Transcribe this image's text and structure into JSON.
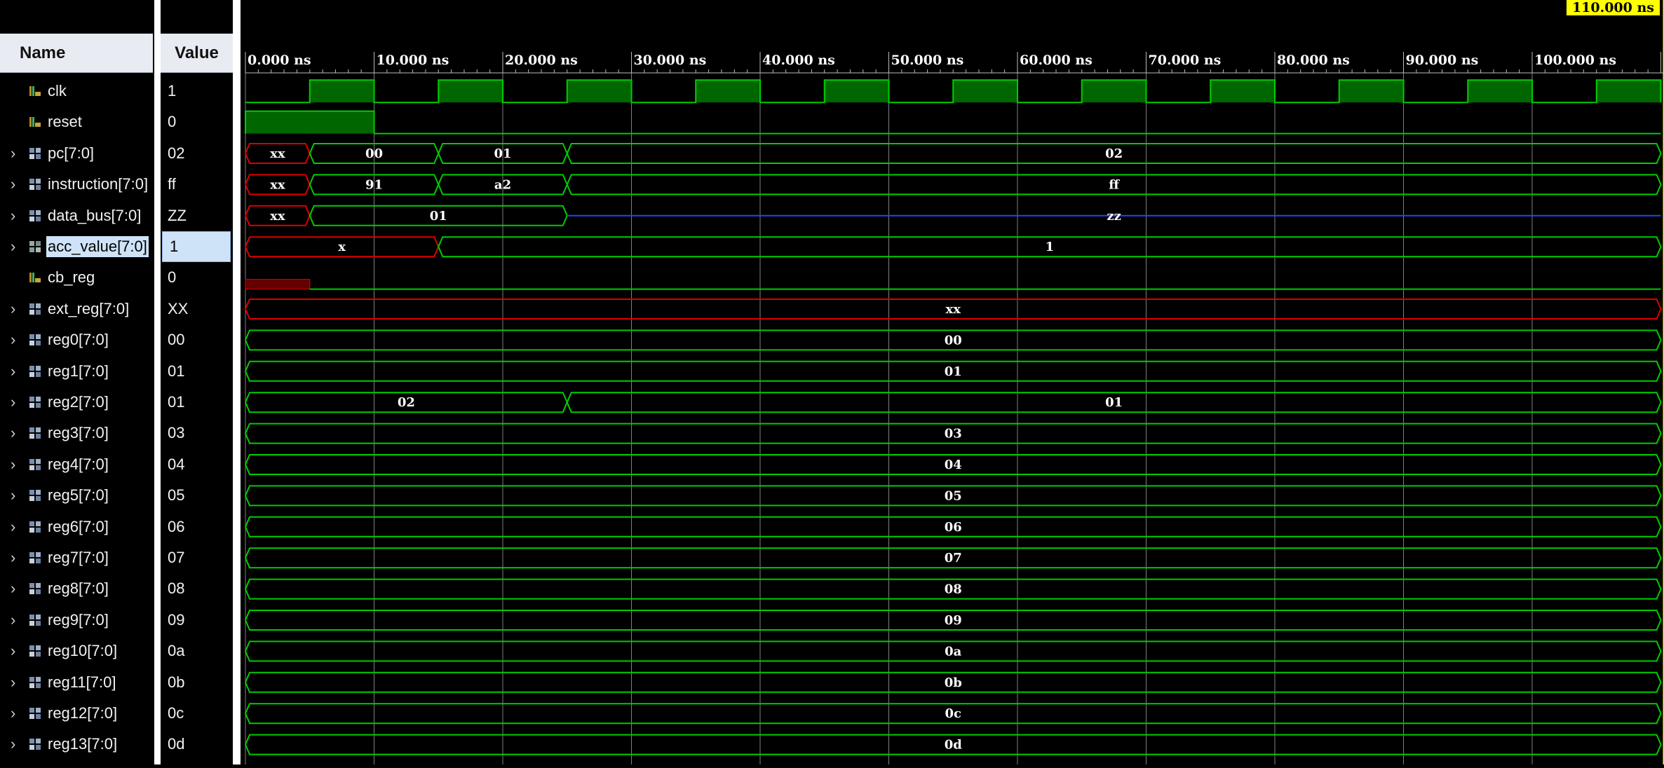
{
  "columns": {
    "name": "Name",
    "value": "Value"
  },
  "cursor": {
    "label": "110.000 ns",
    "time_ns": 110
  },
  "time_axis": {
    "unit": "ns",
    "range_ns": [
      0,
      110
    ],
    "ticks": [
      "0.000 ns",
      "10.000 ns",
      "20.000 ns",
      "30.000 ns",
      "40.000 ns",
      "50.000 ns",
      "60.000 ns",
      "70.000 ns",
      "80.000 ns",
      "90.000 ns",
      "100.000 ns"
    ]
  },
  "colors": {
    "wave": "#00cc00",
    "wave_fill": "#006600",
    "undefined": "#dd0000",
    "high_z": "#2244ff",
    "grid": "#808080",
    "text": "#ffffff"
  },
  "signals": [
    {
      "name": "clk",
      "value": "1",
      "kind": "bit",
      "icon": "bit-signal-icon",
      "expandable": false,
      "wave": {
        "type": "clock",
        "first_high_ns": 5,
        "period_ns": 10
      }
    },
    {
      "name": "reset",
      "value": "0",
      "kind": "bit",
      "icon": "bit-signal-icon",
      "expandable": false,
      "wave": {
        "type": "bit",
        "segments": [
          {
            "t0": 0,
            "t1": 10,
            "v": "1"
          },
          {
            "t0": 10,
            "t1": 110,
            "v": "0"
          }
        ]
      }
    },
    {
      "name": "pc[7:0]",
      "value": "02",
      "kind": "bus",
      "icon": "bus-signal-icon",
      "expandable": true,
      "wave": {
        "type": "bus",
        "segments": [
          {
            "t0": 0,
            "t1": 5,
            "v": "XX",
            "state": "x"
          },
          {
            "t0": 5,
            "t1": 15,
            "v": "00"
          },
          {
            "t0": 15,
            "t1": 25,
            "v": "01"
          },
          {
            "t0": 25,
            "t1": 110,
            "v": "02"
          }
        ]
      }
    },
    {
      "name": "instruction[7:0]",
      "value": "ff",
      "kind": "bus",
      "icon": "bus-signal-icon",
      "expandable": true,
      "wave": {
        "type": "bus",
        "segments": [
          {
            "t0": 0,
            "t1": 5,
            "v": "XX",
            "state": "x"
          },
          {
            "t0": 5,
            "t1": 15,
            "v": "91"
          },
          {
            "t0": 15,
            "t1": 25,
            "v": "a2"
          },
          {
            "t0": 25,
            "t1": 110,
            "v": "ff"
          }
        ]
      }
    },
    {
      "name": "data_bus[7:0]",
      "value": "ZZ",
      "kind": "bus",
      "icon": "bus-signal-icon",
      "expandable": true,
      "wave": {
        "type": "bus",
        "segments": [
          {
            "t0": 0,
            "t1": 5,
            "v": "XX",
            "state": "x"
          },
          {
            "t0": 5,
            "t1": 25,
            "v": "01"
          },
          {
            "t0": 25,
            "t1": 110,
            "v": "ZZ",
            "state": "z"
          }
        ]
      }
    },
    {
      "name": "acc_value[7:0]",
      "value": "1",
      "kind": "bus",
      "icon": "virtual-bus-icon",
      "expandable": true,
      "selected": true,
      "wave": {
        "type": "bus",
        "segments": [
          {
            "t0": 0,
            "t1": 15,
            "v": "X",
            "state": "x"
          },
          {
            "t0": 15,
            "t1": 110,
            "v": "1"
          }
        ]
      }
    },
    {
      "name": "cb_reg",
      "value": "0",
      "kind": "bit",
      "icon": "bit-signal-icon",
      "expandable": false,
      "wave": {
        "type": "bit",
        "segments": [
          {
            "t0": 0,
            "t1": 5,
            "v": "X"
          },
          {
            "t0": 5,
            "t1": 110,
            "v": "0"
          }
        ]
      }
    },
    {
      "name": "ext_reg[7:0]",
      "value": "XX",
      "kind": "bus",
      "icon": "bus-signal-icon",
      "expandable": true,
      "wave": {
        "type": "bus",
        "segments": [
          {
            "t0": 0,
            "t1": 110,
            "v": "XX",
            "state": "x"
          }
        ]
      }
    },
    {
      "name": "reg0[7:0]",
      "value": "00",
      "kind": "bus",
      "icon": "bus-signal-icon",
      "expandable": true,
      "wave": {
        "type": "bus",
        "segments": [
          {
            "t0": 0,
            "t1": 110,
            "v": "00"
          }
        ]
      }
    },
    {
      "name": "reg1[7:0]",
      "value": "01",
      "kind": "bus",
      "icon": "bus-signal-icon",
      "expandable": true,
      "wave": {
        "type": "bus",
        "segments": [
          {
            "t0": 0,
            "t1": 110,
            "v": "01"
          }
        ]
      }
    },
    {
      "name": "reg2[7:0]",
      "value": "01",
      "kind": "bus",
      "icon": "bus-signal-icon",
      "expandable": true,
      "wave": {
        "type": "bus",
        "segments": [
          {
            "t0": 0,
            "t1": 25,
            "v": "02"
          },
          {
            "t0": 25,
            "t1": 110,
            "v": "01"
          }
        ]
      }
    },
    {
      "name": "reg3[7:0]",
      "value": "03",
      "kind": "bus",
      "icon": "bus-signal-icon",
      "expandable": true,
      "wave": {
        "type": "bus",
        "segments": [
          {
            "t0": 0,
            "t1": 110,
            "v": "03"
          }
        ]
      }
    },
    {
      "name": "reg4[7:0]",
      "value": "04",
      "kind": "bus",
      "icon": "bus-signal-icon",
      "expandable": true,
      "wave": {
        "type": "bus",
        "segments": [
          {
            "t0": 0,
            "t1": 110,
            "v": "04"
          }
        ]
      }
    },
    {
      "name": "reg5[7:0]",
      "value": "05",
      "kind": "bus",
      "icon": "bus-signal-icon",
      "expandable": true,
      "wave": {
        "type": "bus",
        "segments": [
          {
            "t0": 0,
            "t1": 110,
            "v": "05"
          }
        ]
      }
    },
    {
      "name": "reg6[7:0]",
      "value": "06",
      "kind": "bus",
      "icon": "bus-signal-icon",
      "expandable": true,
      "wave": {
        "type": "bus",
        "segments": [
          {
            "t0": 0,
            "t1": 110,
            "v": "06"
          }
        ]
      }
    },
    {
      "name": "reg7[7:0]",
      "value": "07",
      "kind": "bus",
      "icon": "bus-signal-icon",
      "expandable": true,
      "wave": {
        "type": "bus",
        "segments": [
          {
            "t0": 0,
            "t1": 110,
            "v": "07"
          }
        ]
      }
    },
    {
      "name": "reg8[7:0]",
      "value": "08",
      "kind": "bus",
      "icon": "bus-signal-icon",
      "expandable": true,
      "wave": {
        "type": "bus",
        "segments": [
          {
            "t0": 0,
            "t1": 110,
            "v": "08"
          }
        ]
      }
    },
    {
      "name": "reg9[7:0]",
      "value": "09",
      "kind": "bus",
      "icon": "bus-signal-icon",
      "expandable": true,
      "wave": {
        "type": "bus",
        "segments": [
          {
            "t0": 0,
            "t1": 110,
            "v": "09"
          }
        ]
      }
    },
    {
      "name": "reg10[7:0]",
      "value": "0a",
      "kind": "bus",
      "icon": "bus-signal-icon",
      "expandable": true,
      "wave": {
        "type": "bus",
        "segments": [
          {
            "t0": 0,
            "t1": 110,
            "v": "0a"
          }
        ]
      }
    },
    {
      "name": "reg11[7:0]",
      "value": "0b",
      "kind": "bus",
      "icon": "bus-signal-icon",
      "expandable": true,
      "wave": {
        "type": "bus",
        "segments": [
          {
            "t0": 0,
            "t1": 110,
            "v": "0b"
          }
        ]
      }
    },
    {
      "name": "reg12[7:0]",
      "value": "0c",
      "kind": "bus",
      "icon": "bus-signal-icon",
      "expandable": true,
      "wave": {
        "type": "bus",
        "segments": [
          {
            "t0": 0,
            "t1": 110,
            "v": "0c"
          }
        ]
      }
    },
    {
      "name": "reg13[7:0]",
      "value": "0d",
      "kind": "bus",
      "icon": "bus-signal-icon",
      "expandable": true,
      "wave": {
        "type": "bus",
        "segments": [
          {
            "t0": 0,
            "t1": 110,
            "v": "0d"
          }
        ]
      }
    }
  ]
}
